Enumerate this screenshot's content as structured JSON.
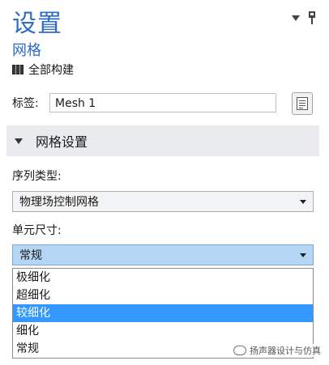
{
  "panel": {
    "title": "设置",
    "subtitle": "网格",
    "build_all_label": "全部构建"
  },
  "label_field": {
    "label": "标签:",
    "value": "Mesh 1"
  },
  "section": {
    "title": "网格设置"
  },
  "sequence_type": {
    "label": "序列类型:",
    "selected": "物理场控制网格"
  },
  "element_size": {
    "label": "单元尺寸:",
    "selected": "常规",
    "options": [
      "极细化",
      "超细化",
      "较细化",
      "细化",
      "常规"
    ],
    "highlighted_option": "较细化"
  },
  "watermark": {
    "text": "扬声器设计与仿真"
  },
  "colors": {
    "title_blue": "#2e6bc4",
    "section_bg": "#e9ebee",
    "open_select_bg": "#b5d5f5",
    "highlight": "#3399ff"
  }
}
